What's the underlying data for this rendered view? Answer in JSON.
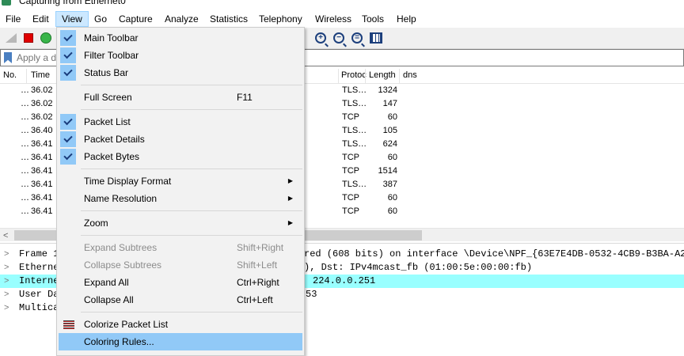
{
  "window": {
    "title": "Capturing from Ethernet0"
  },
  "menubar": {
    "items": [
      "File",
      "Edit",
      "View",
      "Go",
      "Capture",
      "Analyze",
      "Statistics",
      "Telephony",
      "Wireless",
      "Tools",
      "Help"
    ],
    "active": "View"
  },
  "toolbar": {
    "icons": [
      "shark-fin-icon",
      "stop-capture-icon",
      "restart-capture-icon",
      "zoom-in-icon",
      "zoom-out-icon",
      "normal-size-icon",
      "resize-columns-icon"
    ]
  },
  "filter": {
    "placeholder": "Apply a di"
  },
  "packet_list": {
    "headers": {
      "no": "No.",
      "time": "Time",
      "protocol": "Protoc",
      "length": "Length",
      "info": "dns"
    },
    "rows": [
      {
        "no": "…",
        "time": "36.02",
        "protocol": "TLS…",
        "length": "1324"
      },
      {
        "no": "…",
        "time": "36.02",
        "protocol": "TLS…",
        "length": "147"
      },
      {
        "no": "…",
        "time": "36.02",
        "protocol": "TCP",
        "length": "60"
      },
      {
        "no": "…",
        "time": "36.40",
        "protocol": "TLS…",
        "length": "105"
      },
      {
        "no": "…",
        "time": "36.41",
        "protocol": "TLS…",
        "length": "624"
      },
      {
        "no": "…",
        "time": "36.41",
        "protocol": "TCP",
        "length": "60"
      },
      {
        "no": "…",
        "time": "36.41",
        "protocol": "TCP",
        "length": "1514"
      },
      {
        "no": "…",
        "time": "36.41",
        "protocol": "TLS…",
        "length": "387"
      },
      {
        "no": "…",
        "time": "36.41",
        "protocol": "TCP",
        "length": "60"
      },
      {
        "no": "…",
        "time": "36.41",
        "protocol": "TCP",
        "length": "60"
      }
    ]
  },
  "details": {
    "rows": [
      {
        "left": "Frame 1",
        "right": "red (608 bits) on interface \\Device\\NPF_{63E7E4DB-0532-4CB9-B3BA-A25"
      },
      {
        "left": "Etherne",
        "right": "), Dst: IPv4mcast_fb (01:00:5e:00:00:fb)"
      },
      {
        "left": "Interne",
        "right": "224.0.0.251"
      },
      {
        "left": "User Da",
        "right": "53"
      },
      {
        "left": "Multica",
        "right": ""
      }
    ]
  },
  "view_menu": {
    "items": [
      {
        "label": "Main Toolbar",
        "checked": true
      },
      {
        "label": "Filter Toolbar",
        "checked": true
      },
      {
        "label": "Status Bar",
        "checked": true
      },
      {
        "label": "Full Screen",
        "shortcut": "F11"
      },
      {
        "label": "Packet List",
        "checked": true
      },
      {
        "label": "Packet Details",
        "checked": true
      },
      {
        "label": "Packet Bytes",
        "checked": true
      },
      {
        "label": "Time Display Format",
        "submenu": true
      },
      {
        "label": "Name Resolution",
        "submenu": true
      },
      {
        "label": "Zoom",
        "submenu": true
      },
      {
        "label": "Expand Subtrees",
        "shortcut": "Shift+Right",
        "disabled": true
      },
      {
        "label": "Collapse Subtrees",
        "shortcut": "Shift+Left",
        "disabled": true
      },
      {
        "label": "Expand All",
        "shortcut": "Ctrl+Right"
      },
      {
        "label": "Collapse All",
        "shortcut": "Ctrl+Left"
      },
      {
        "label": "Colorize Packet List"
      },
      {
        "label": "Coloring Rules...",
        "hovered": true
      }
    ]
  },
  "colors": {
    "menu_highlight": "#91c9f7",
    "selected_detail_row": "#99ffff",
    "stop_button": "#e00000"
  }
}
